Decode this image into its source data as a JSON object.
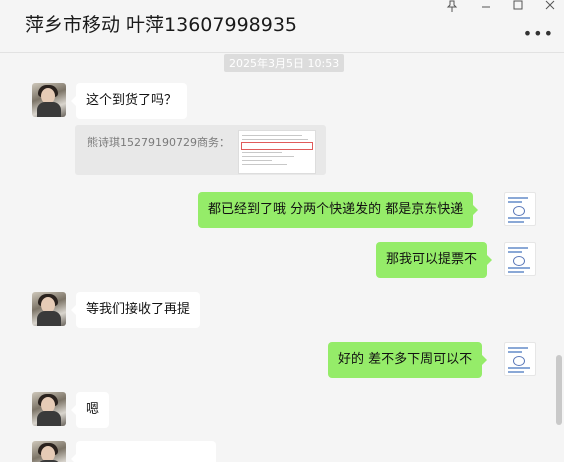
{
  "header": {
    "title": "萍乡市移动 叶萍13607998935",
    "pin_icon": "pin-icon",
    "minimize_icon": "minimize-icon",
    "maximize_icon": "maximize-icon",
    "close_icon": "close-icon",
    "more_icon": "more-icon"
  },
  "chat": {
    "timestamp": "2025年3月5日 10:53",
    "messages": [
      {
        "side": "in",
        "text": "这个到货了吗？"
      },
      {
        "side": "in-quote",
        "text": "熊诗琪15279190729商务："
      },
      {
        "side": "out",
        "text": "都已经到了哦 分两个快递发的 都是京东快递"
      },
      {
        "side": "out",
        "text": "那我可以提票不"
      },
      {
        "side": "in",
        "text": "等我们接收了再提"
      },
      {
        "side": "out",
        "text": "好的 差不多下周可以不"
      },
      {
        "side": "in",
        "text": "嗯"
      }
    ]
  },
  "colors": {
    "outgoing_bubble": "#95ec69",
    "incoming_bubble": "#ffffff",
    "background": "#f5f5f5"
  }
}
